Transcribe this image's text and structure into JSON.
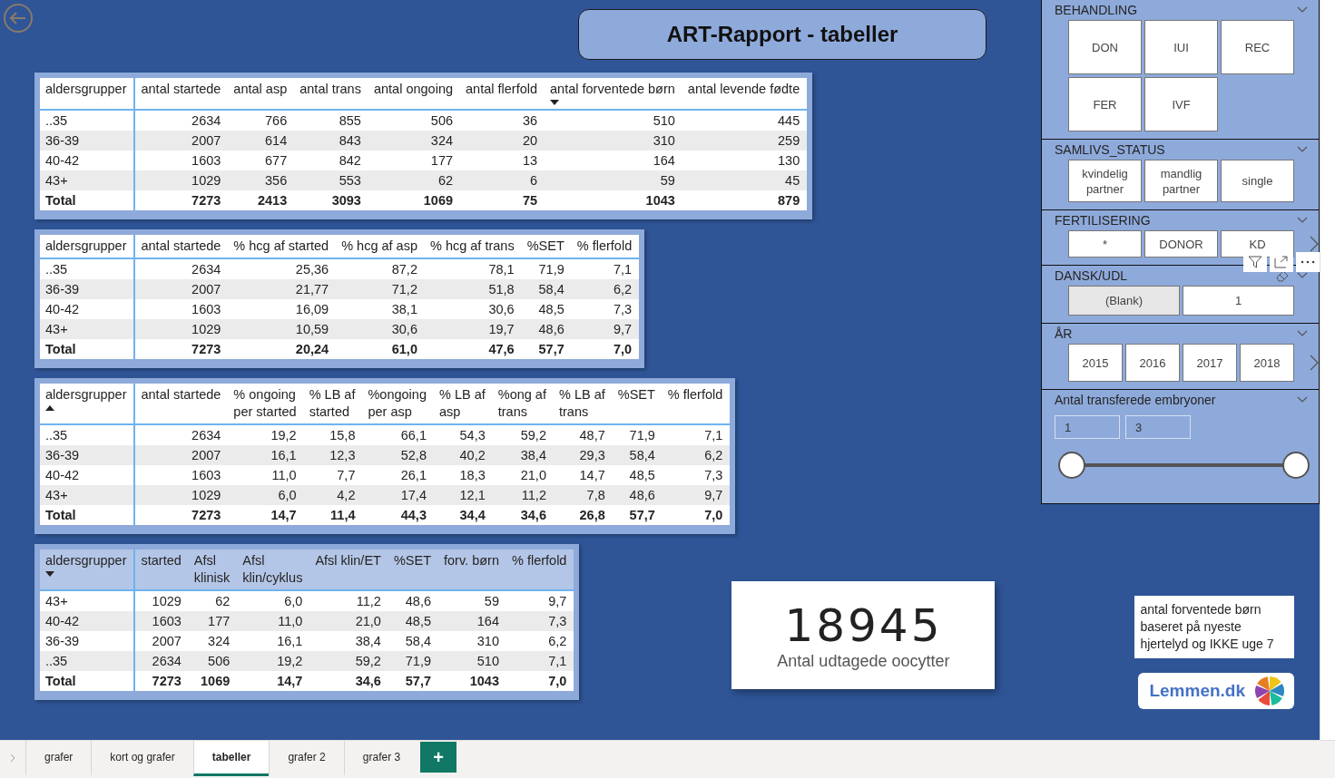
{
  "title": "ART-Rapport - tabeller",
  "tables": [
    {
      "header_shaded": false,
      "columns": [
        {
          "label": "aldersgrupper"
        },
        {
          "label": "antal startede"
        },
        {
          "label": "antal asp"
        },
        {
          "label": "antal trans"
        },
        {
          "label": "antal ongoing"
        },
        {
          "label": "antal flerfold"
        },
        {
          "label": "antal forventede børn",
          "sorted_descending": true
        },
        {
          "label": "antal levende fødte"
        }
      ],
      "rows": [
        [
          "..35",
          "2634",
          "766",
          "855",
          "506",
          "36",
          "510",
          "445"
        ],
        [
          "36-39",
          "2007",
          "614",
          "843",
          "324",
          "20",
          "310",
          "259"
        ],
        [
          "40-42",
          "1603",
          "677",
          "842",
          "177",
          "13",
          "164",
          "130"
        ],
        [
          "43+",
          "1029",
          "356",
          "553",
          "62",
          "6",
          "59",
          "45"
        ]
      ],
      "total": [
        "Total",
        "7273",
        "2413",
        "3093",
        "1069",
        "75",
        "1043",
        "879"
      ]
    },
    {
      "header_shaded": false,
      "columns": [
        {
          "label": "aldersgrupper"
        },
        {
          "label": "antal startede"
        },
        {
          "label": "% hcg af started"
        },
        {
          "label": "% hcg af asp"
        },
        {
          "label": "% hcg af trans"
        },
        {
          "label": "%SET"
        },
        {
          "label": "% flerfold"
        }
      ],
      "rows": [
        [
          "..35",
          "2634",
          "25,36",
          "87,2",
          "78,1",
          "71,9",
          "7,1"
        ],
        [
          "36-39",
          "2007",
          "21,77",
          "71,2",
          "51,8",
          "58,4",
          "6,2"
        ],
        [
          "40-42",
          "1603",
          "16,09",
          "38,1",
          "30,6",
          "48,5",
          "7,3"
        ],
        [
          "43+",
          "1029",
          "10,59",
          "30,6",
          "19,7",
          "48,6",
          "9,7"
        ]
      ],
      "total": [
        "Total",
        "7273",
        "20,24",
        "61,0",
        "47,6",
        "57,7",
        "7,0"
      ]
    },
    {
      "header_shaded": false,
      "columns": [
        {
          "label": "aldersgrupper",
          "sorted_ascending": true
        },
        {
          "label": "antal startede"
        },
        {
          "label": "% ongoing\nper started"
        },
        {
          "label": "% LB af\nstarted"
        },
        {
          "label": "%ongoing\nper asp"
        },
        {
          "label": "% LB af\nasp"
        },
        {
          "label": "%ong af\ntrans"
        },
        {
          "label": "% LB af\ntrans"
        },
        {
          "label": "%SET"
        },
        {
          "label": "% flerfold"
        }
      ],
      "rows": [
        [
          "..35",
          "2634",
          "19,2",
          "15,8",
          "66,1",
          "54,3",
          "59,2",
          "48,7",
          "71,9",
          "7,1"
        ],
        [
          "36-39",
          "2007",
          "16,1",
          "12,3",
          "52,8",
          "40,2",
          "38,4",
          "29,3",
          "58,4",
          "6,2"
        ],
        [
          "40-42",
          "1603",
          "11,0",
          "7,7",
          "26,1",
          "18,3",
          "21,0",
          "14,7",
          "48,5",
          "7,3"
        ],
        [
          "43+",
          "1029",
          "6,0",
          "4,2",
          "17,4",
          "12,1",
          "11,2",
          "7,8",
          "48,6",
          "9,7"
        ]
      ],
      "total": [
        "Total",
        "7273",
        "14,7",
        "11,4",
        "44,3",
        "34,4",
        "34,6",
        "26,8",
        "57,7",
        "7,0"
      ]
    },
    {
      "header_shaded": true,
      "columns": [
        {
          "label": "aldersgrupper",
          "sorted_descending": true
        },
        {
          "label": "started"
        },
        {
          "label": "Afsl\nklinisk"
        },
        {
          "label": "Afsl\nklin/cyklus"
        },
        {
          "label": "Afsl klin/ET"
        },
        {
          "label": "%SET"
        },
        {
          "label": "forv. børn"
        },
        {
          "label": "% flerfold"
        }
      ],
      "rows": [
        [
          "43+",
          "1029",
          "62",
          "6,0",
          "11,2",
          "48,6",
          "59",
          "9,7"
        ],
        [
          "40-42",
          "1603",
          "177",
          "11,0",
          "21,0",
          "48,5",
          "164",
          "7,3"
        ],
        [
          "36-39",
          "2007",
          "324",
          "16,1",
          "38,4",
          "58,4",
          "310",
          "6,2"
        ],
        [
          "..35",
          "2634",
          "506",
          "19,2",
          "59,2",
          "71,9",
          "510",
          "7,1"
        ]
      ],
      "total": [
        "Total",
        "7273",
        "1069",
        "14,7",
        "34,6",
        "57,7",
        "1043",
        "7,0"
      ]
    }
  ],
  "kpi": {
    "value": "18945",
    "label": "Antal udtagede oocytter"
  },
  "note": "antal forventede børn baseret på nyeste hjertelyd og IKKE uge 7",
  "logo": {
    "text": "Lemmen.dk"
  },
  "slicers": [
    {
      "kind": "grid",
      "title": "BEHANDLING",
      "items": [
        {
          "label": "DON",
          "selected": false
        },
        {
          "label": "IUI",
          "selected": false
        },
        {
          "label": "REC",
          "selected": false
        },
        {
          "label": "FER",
          "selected": false
        },
        {
          "label": "IVF",
          "selected": false
        }
      ]
    },
    {
      "kind": "twoline",
      "title": "SAMLIVS_STATUS",
      "items": [
        {
          "label": "kvindelig partner",
          "selected": false
        },
        {
          "label": "mandlig partner",
          "selected": false
        },
        {
          "label": "single",
          "selected": false
        }
      ]
    },
    {
      "kind": "strip",
      "title": "FERTILISERING",
      "more": true,
      "hovered": true,
      "items": [
        {
          "label": "*",
          "selected": false
        },
        {
          "label": "DONOR",
          "selected": false
        },
        {
          "label": "KD",
          "selected": false
        }
      ]
    },
    {
      "kind": "pair",
      "title": "DANSK/UDL",
      "clearable": true,
      "items": [
        {
          "label": "(Blank)",
          "selected": true
        },
        {
          "label": "1",
          "selected": false
        }
      ]
    },
    {
      "kind": "years",
      "title": "ÅR",
      "more": true,
      "items": [
        {
          "label": "2015",
          "selected": false
        },
        {
          "label": "2016",
          "selected": false
        },
        {
          "label": "2017",
          "selected": false
        },
        {
          "label": "2018",
          "selected": false
        }
      ]
    },
    {
      "kind": "range",
      "title": "Antal transferede embryoner",
      "from": "1",
      "to": "3",
      "thumbs": [
        {
          "level": 0
        },
        {
          "level": 1
        }
      ]
    }
  ],
  "tabs": [
    {
      "label": "grafer",
      "selected": false
    },
    {
      "label": "kort og grafer",
      "selected": false
    },
    {
      "label": "tabeller",
      "selected": true
    },
    {
      "label": "grafer 2",
      "selected": false
    },
    {
      "label": "grafer 3",
      "selected": false
    }
  ],
  "add_tab": "+"
}
